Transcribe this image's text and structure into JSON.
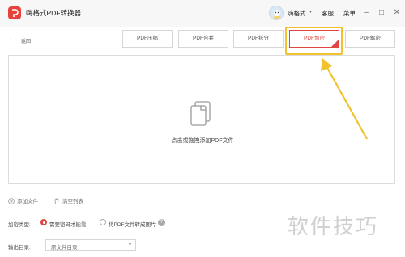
{
  "app": {
    "title": "嗨格式PDF转换器",
    "username": "嗨格式",
    "support_label": "客服",
    "menu_label": "菜单"
  },
  "toolbar": {
    "back_label": "返回",
    "tabs": [
      {
        "label": "PDF压缩"
      },
      {
        "label": "PDF合并"
      },
      {
        "label": "PDF拆分"
      },
      {
        "label": "PDF加密"
      },
      {
        "label": "PDF解密"
      }
    ],
    "active_tab": "PDF加密"
  },
  "dropzone": {
    "text": "点击或拖拽添加PDF文件",
    "icon": "file-stack-icon"
  },
  "actions": {
    "add_file": "添加文件",
    "clear_list": "清空列表"
  },
  "options": {
    "encrypt_type_label": "加密类型:",
    "option_password": "需要密码才能看",
    "option_image": "将PDF文件转成图片",
    "output_label": "输出目录:",
    "output_value": "原文件目录"
  },
  "watermark": "软件技巧",
  "colors": {
    "accent": "#e0463f",
    "highlight": "#f2c22d"
  }
}
